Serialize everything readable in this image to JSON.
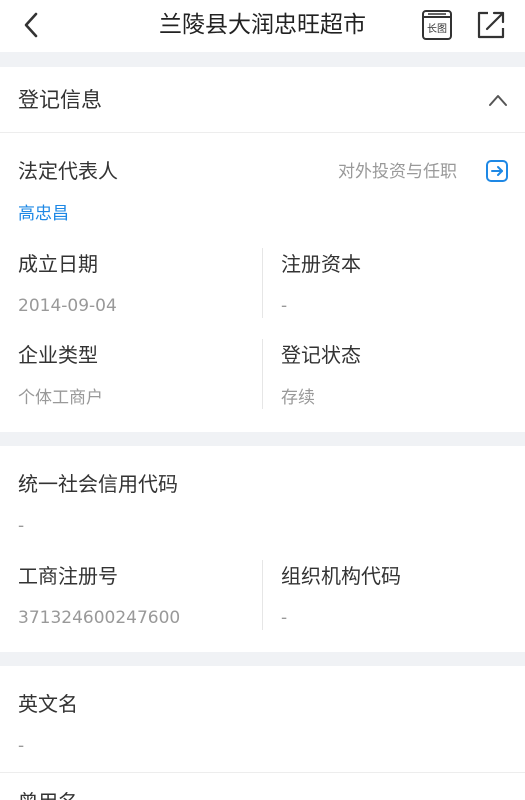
{
  "header": {
    "title": "兰陵县大润忠旺超市",
    "long_image_label": "长图",
    "icons": {
      "back": "chevron-left-icon",
      "long_image": "long-image-icon",
      "share": "share-icon"
    }
  },
  "registration": {
    "section_title": "登记信息",
    "legal_rep_label": "法定代表人",
    "legal_rep_name": "高忠昌",
    "investment_link": "对外投资与任职",
    "established_label": "成立日期",
    "established_value": "2014-09-04",
    "capital_label": "注册资本",
    "capital_value": "-",
    "company_type_label": "企业类型",
    "company_type_value": "个体工商户",
    "status_label": "登记状态",
    "status_value": "存续"
  },
  "codes": {
    "credit_code_label": "统一社会信用代码",
    "credit_code_value": "-",
    "reg_no_label": "工商注册号",
    "reg_no_value": "371324600247600",
    "org_code_label": "组织机构代码",
    "org_code_value": "-"
  },
  "names": {
    "english_name_label": "英文名",
    "english_name_value": "-",
    "next_label_partial": "曾用名"
  },
  "colors": {
    "accent": "#1e88e5",
    "separator": "#f0f2f5",
    "muted": "#999999",
    "text": "#333333"
  }
}
